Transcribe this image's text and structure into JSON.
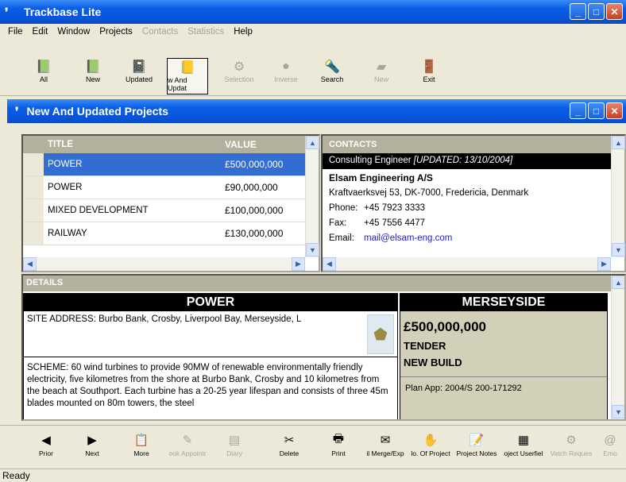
{
  "app": {
    "title": "Trackbase Lite"
  },
  "menu": [
    "File",
    "Edit",
    "Window",
    "Projects",
    "Contacts",
    "Statistics",
    "Help"
  ],
  "menu_disabled": [
    false,
    false,
    false,
    false,
    true,
    true,
    false
  ],
  "toolbar": [
    {
      "label": "All",
      "icon": "folder-all-icon"
    },
    {
      "label": "New",
      "icon": "folder-new-icon"
    },
    {
      "label": "Updated",
      "icon": "folder-updated-icon"
    },
    {
      "label": "w And Updat",
      "icon": "folder-new-updated-icon"
    },
    {
      "label": "Selection",
      "icon": "selection-icon"
    },
    {
      "label": "Inverse",
      "icon": "inverse-icon"
    },
    {
      "label": "Search",
      "icon": "search-icon"
    },
    {
      "label": "New",
      "icon": "new-doc-icon"
    },
    {
      "label": "Exit",
      "icon": "exit-door-icon"
    }
  ],
  "child": {
    "title": "New And Updated Projects"
  },
  "projects": {
    "headers": [
      "TITLE",
      "VALUE"
    ],
    "rows": [
      {
        "title": "POWER",
        "value": "£500,000,000"
      },
      {
        "title": "POWER",
        "value": "£90,000,000"
      },
      {
        "title": "MIXED DEVELOPMENT",
        "value": "£100,000,000"
      },
      {
        "title": "RAILWAY",
        "value": "£130,000,000"
      }
    ]
  },
  "contacts": {
    "header": "CONTACTS",
    "role": "Consulting Engineer",
    "updated": "[UPDATED: 13/10/2004]",
    "company": "Elsam Engineering A/S",
    "address": "Kraftvaerksvej 53, DK-7000, Fredericia, Denmark",
    "phone_label": "Phone:",
    "phone": "+45 7923 3333",
    "fax_label": "Fax:",
    "fax": "+45 7556 4477",
    "email_label": "Email:",
    "email": "mail@elsam-eng.com"
  },
  "details": {
    "header": "DETAILS",
    "title": "POWER",
    "site": "SITE ADDRESS: Burbo Bank, Crosby, Liverpool Bay, Merseyside, L",
    "scheme": "SCHEME: 60 wind turbines to provide 90MW of renewable environmentally friendly electricity, five kilometres from the shore at Burbo Bank, Crosby and 10 kilometres from the beach at Southport. Each turbine has a 20-25 year lifespan and consists of three 45m blades mounted on 80m towers, the steel",
    "region": "MERSEYSIDE",
    "value": "£500,000,000",
    "stage": "TENDER",
    "type": "NEW BUILD",
    "plan": "Plan App: 2004/S 200-171292"
  },
  "bottombar": [
    {
      "label": "Prior",
      "icon": "arrow-left-icon"
    },
    {
      "label": "Next",
      "icon": "arrow-right-icon"
    },
    {
      "label": "More",
      "icon": "more-icon"
    },
    {
      "label": "ook Appointr",
      "icon": "appointment-icon"
    },
    {
      "label": "Diary",
      "icon": "diary-icon"
    },
    {
      "label": "Delete",
      "icon": "delete-icon"
    },
    {
      "label": "Print",
      "icon": "printer-icon"
    },
    {
      "label": "il Merge/Exp",
      "icon": "mail-merge-icon"
    },
    {
      "label": "lo. Of Project",
      "icon": "projects-count-icon"
    },
    {
      "label": "Project Notes",
      "icon": "notes-icon"
    },
    {
      "label": "oject Userfiel",
      "icon": "userfield-icon"
    },
    {
      "label": "Vatch Reques",
      "icon": "watch-icon"
    },
    {
      "label": "Emo",
      "icon": "email-icon"
    }
  ],
  "status": "Ready"
}
